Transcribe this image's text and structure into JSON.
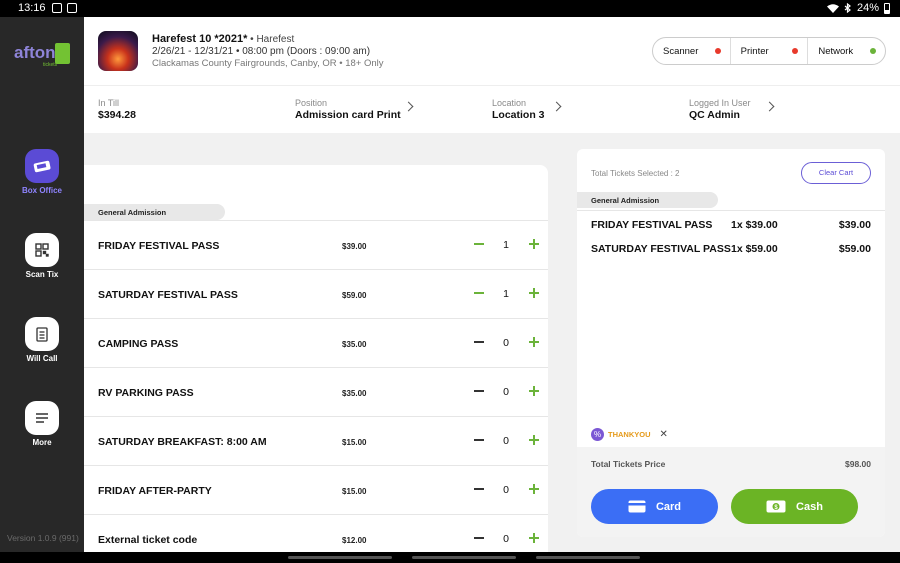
{
  "status_bar": {
    "time": "13:16",
    "battery": "24%"
  },
  "app": {
    "logo_text": "afton",
    "logo_sub": "tickets",
    "version": "Version 1.0.9 (991)",
    "nav": [
      {
        "label": "Box Office",
        "icon": "ticket-icon",
        "active": true
      },
      {
        "label": "Scan Tix",
        "icon": "qr-code-icon",
        "active": false
      },
      {
        "label": "Will Call",
        "icon": "document-icon",
        "active": false
      },
      {
        "label": "More",
        "icon": "menu-icon",
        "active": false
      }
    ]
  },
  "event": {
    "title": "Harefest 10 *2021*",
    "subtitle": " • Harefest",
    "dates": "2/26/21 - 12/31/21 • 08:00 pm (Doors : 09:00 am)",
    "location": "Clackamas County Fairgrounds, Canby, OR • 18+ Only"
  },
  "devices": [
    {
      "label": "Scanner",
      "status_color": "#e8392b"
    },
    {
      "label": "Printer",
      "status_color": "#e8392b"
    },
    {
      "label": "Network",
      "status_color": "#6bb33a"
    }
  ],
  "info": {
    "in_till_label": "In Till",
    "in_till_value": "$394.28",
    "position_label": "Position",
    "position_value": "Admission card Print",
    "location_label": "Location",
    "location_value": "Location 3",
    "user_label": "Logged In User",
    "user_value": "QC Admin"
  },
  "tickets": {
    "section": "General Admission",
    "items": [
      {
        "name": "FRIDAY FESTIVAL PASS",
        "price": "$39.00",
        "qty": "1"
      },
      {
        "name": "SATURDAY FESTIVAL PASS",
        "price": "$59.00",
        "qty": "1"
      },
      {
        "name": "CAMPING PASS",
        "price": "$35.00",
        "qty": "0"
      },
      {
        "name": "RV PARKING PASS",
        "price": "$35.00",
        "qty": "0"
      },
      {
        "name": "SATURDAY BREAKFAST: 8:00 AM",
        "price": "$15.00",
        "qty": "0"
      },
      {
        "name": "FRIDAY AFTER-PARTY",
        "price": "$15.00",
        "qty": "0"
      },
      {
        "name": "External ticket code",
        "price": "$12.00",
        "qty": "0"
      }
    ]
  },
  "cart": {
    "selected_text": "Total Tickets Selected : 2",
    "clear_label": "Clear Cart",
    "section": "General Admission",
    "items": [
      {
        "name": "FRIDAY FESTIVAL PASS",
        "qty_price": "1x $39.00",
        "total": "$39.00"
      },
      {
        "name": "SATURDAY FESTIVAL PASS",
        "qty_price": "1x $59.00",
        "total": "$59.00"
      }
    ],
    "promo_code": "THANKYOU",
    "total_label": "Total Tickets Price",
    "total_value": "$98.00",
    "card_label": "Card",
    "cash_label": "Cash"
  }
}
